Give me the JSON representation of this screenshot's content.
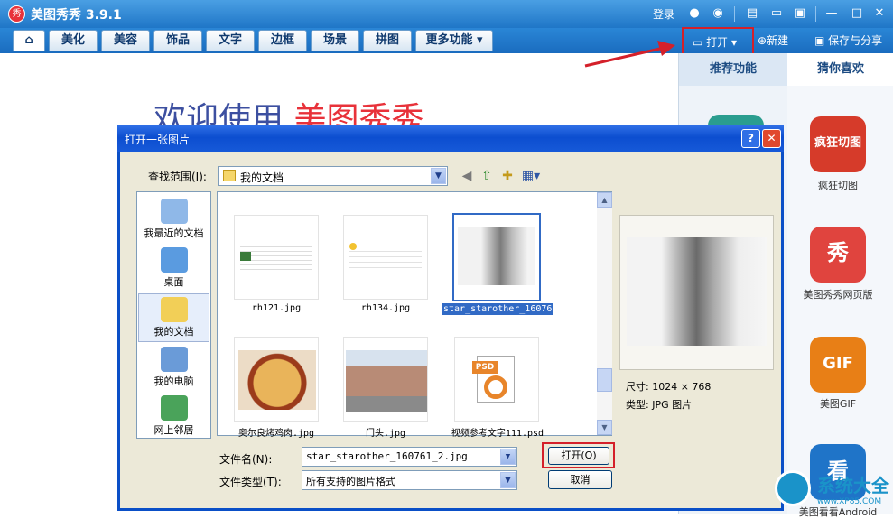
{
  "app": {
    "title": "美图秀秀 3.9.1",
    "logo_char": "秀",
    "titlebar": {
      "login": "登录"
    },
    "tabs": [
      "美化",
      "美容",
      "饰品",
      "文字",
      "边框",
      "场景",
      "拼图",
      "更多功能 ▾"
    ],
    "toolbar": {
      "open": "打开",
      "new": "新建",
      "save_share": "保存与分享"
    },
    "welcome_prefix": "欢迎使用",
    "welcome_brand": "美图秀秀"
  },
  "right_panel": {
    "tabs": [
      "推荐功能",
      "猜你喜欢"
    ],
    "apps": [
      {
        "label": "疯狂切图",
        "icon_text": "疯狂切图",
        "color": "#d63b2a"
      },
      {
        "label": "美图秀秀网页版",
        "icon_text": "秀",
        "color": "#e0443e"
      },
      {
        "label": "美图GIF",
        "icon_text": "GIF",
        "color": "#e87f16"
      },
      {
        "label": "美图看看Android",
        "icon_text": "看",
        "color": "#1f74c8"
      }
    ]
  },
  "dialog": {
    "title": "打开一张图片",
    "help": "?",
    "close": "✕",
    "look_in_label": "查找范围(I):",
    "look_in_value": "我的文档",
    "places": [
      {
        "label": "我最近的文档",
        "color": "#8fb8e8"
      },
      {
        "label": "桌面",
        "color": "#5a9be0"
      },
      {
        "label": "我的文档",
        "color": "#f2cf57"
      },
      {
        "label": "我的电脑",
        "color": "#6a9bd8"
      },
      {
        "label": "网上邻居",
        "color": "#4aa35a"
      }
    ],
    "files": [
      {
        "name": "rh121.jpg"
      },
      {
        "name": "rh134.jpg"
      },
      {
        "name": "star_starother_160761_2.jpg"
      },
      {
        "name": "奥尔良烤鸡肉.jpg"
      },
      {
        "name": "门头.jpg"
      },
      {
        "name": "视频参考文字111.psd"
      }
    ],
    "psd_badge": "PSD",
    "info": {
      "size_label": "尺寸:",
      "size_value": "1024 × 768",
      "type_label": "类型:",
      "type_value": "JPG 图片"
    },
    "filename_label": "文件名(N):",
    "filename_value": "star_starother_160761_2.jpg",
    "filetype_label": "文件类型(T):",
    "filetype_value": "所有支持的图片格式",
    "open_button": "打开(O)",
    "cancel_button": "取消"
  },
  "watermark": {
    "text": "系统大全",
    "url": "www.XP85.COM"
  }
}
